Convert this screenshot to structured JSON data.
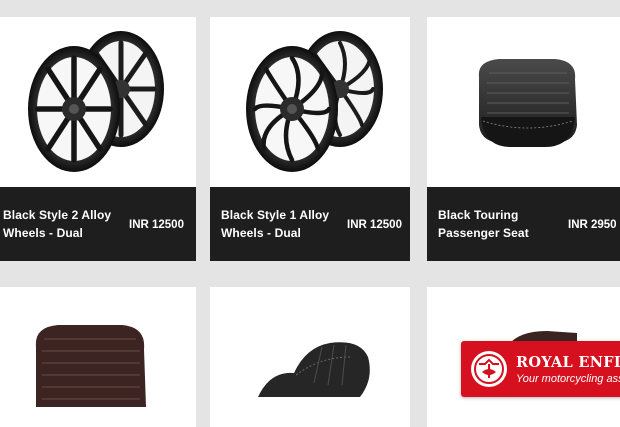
{
  "products": [
    {
      "name": "Black Style 2 Alloy Wheels - Dual",
      "price": "INR 12500",
      "image": "black-alloy-wheels-pair"
    },
    {
      "name": "Black Style 1 Alloy Wheels - Dual",
      "price": "INR 12500",
      "image": "black-alloy-wheels-pair"
    },
    {
      "name": "Black Touring Passenger Seat",
      "price": "INR 2950",
      "image": "black-passenger-seat"
    },
    {
      "image": "brown-passenger-seat"
    },
    {
      "image": "black-rider-seat"
    },
    {
      "image": "passenger-seat"
    }
  ],
  "badge": {
    "brand": "ROYAL ENFIELD",
    "tagline": "Your motorcycling assist",
    "accent": "#d6101e"
  },
  "colors": {
    "background": "#e4e4e4",
    "card": "#ffffff",
    "bar": "#1e1e1e"
  }
}
